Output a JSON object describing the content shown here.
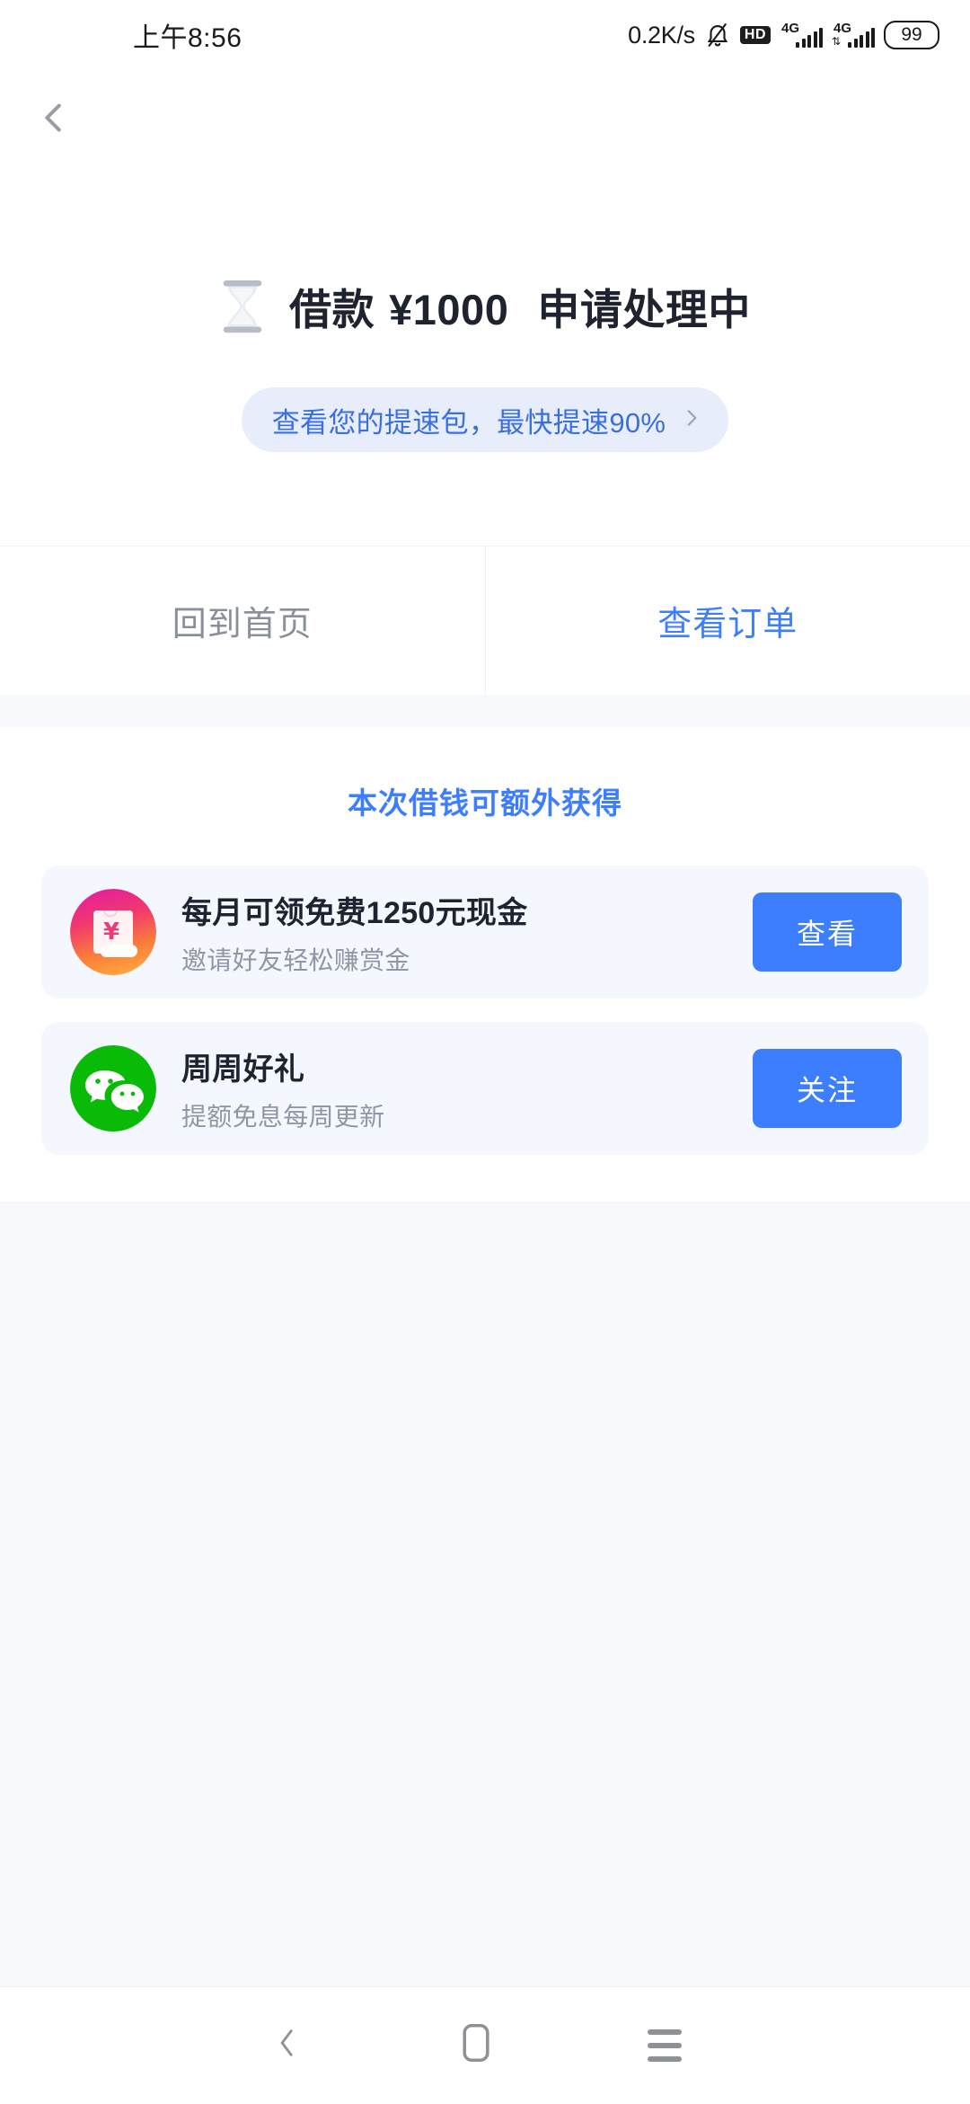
{
  "statusbar": {
    "time": "上午8:56",
    "network_speed": "0.2K/s",
    "mute_icon": "bell-muted-icon",
    "hd_label": "HD",
    "sim1_label": "4G",
    "sim2_label": "4G",
    "battery_level": "99"
  },
  "header": {
    "back_icon": "chevron-left-icon"
  },
  "hero": {
    "status_icon": "hourglass-icon",
    "title_prefix": "借款",
    "amount": "¥1000",
    "status_text": "申请处理中",
    "promo_text": "查看您的提速包，最快提速90%",
    "promo_chevron": "chevron-right-icon"
  },
  "actions": {
    "home_label": "回到首页",
    "order_label": "查看订单"
  },
  "rewards": {
    "section_title": "本次借钱可额外获得",
    "cards": [
      {
        "icon": "cash-voucher-icon",
        "title": "每月可领免费1250元现金",
        "subtitle": "邀请好友轻松赚赏金",
        "button_label": "查看"
      },
      {
        "icon": "wechat-icon",
        "title": "周周好礼",
        "subtitle": "提额免息每周更新",
        "button_label": "关注"
      }
    ]
  },
  "navbar": {
    "back_icon": "nav-back-icon",
    "home_icon": "nav-home-icon",
    "recents_icon": "nav-recents-icon"
  },
  "colors": {
    "accent_blue": "#3d7eff",
    "promo_bg": "#e8edfb",
    "card_bg": "#f4f7fd",
    "page_gray": "#f7f9fc",
    "wechat_green": "#09bb07",
    "text_dark": "#1f2330",
    "text_muted": "#9096a3"
  }
}
